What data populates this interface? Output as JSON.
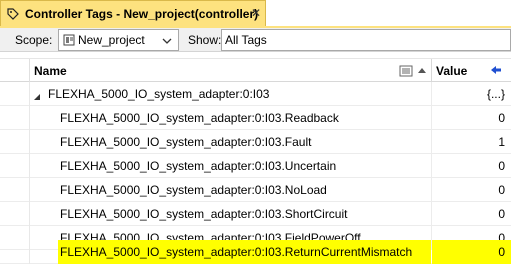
{
  "tab": {
    "title": "Controller Tags - New_project(controller)",
    "close_glyph": "✕"
  },
  "toolbar": {
    "scope_label": "Scope:",
    "scope_value": "New_project",
    "show_label": "Show:",
    "show_value": "All Tags"
  },
  "grid": {
    "columns": {
      "name": "Name",
      "value": "Value"
    },
    "parent": {
      "name": "FLEXHA_5000_IO_system_adapter:0:I03",
      "value": "{...}"
    },
    "rows": [
      {
        "name": "FLEXHA_5000_IO_system_adapter:0:I03.Readback",
        "value": "0"
      },
      {
        "name": "FLEXHA_5000_IO_system_adapter:0:I03.Fault",
        "value": "1"
      },
      {
        "name": "FLEXHA_5000_IO_system_adapter:0:I03.Uncertain",
        "value": "0"
      },
      {
        "name": "FLEXHA_5000_IO_system_adapter:0:I03.NoLoad",
        "value": "0"
      },
      {
        "name": "FLEXHA_5000_IO_system_adapter:0:I03.ShortCircuit",
        "value": "0"
      },
      {
        "name": "FLEXHA_5000_IO_system_adapter:0:I03.FieldPowerOff",
        "value": "0"
      },
      {
        "name": "FLEXHA_5000_IO_system_adapter:0:I03.ReturnCurrentMismatch",
        "value": "0",
        "highlighted": true
      }
    ]
  },
  "colors": {
    "tab_accent": "#fde27f",
    "highlight": "#ffff00",
    "arrow_blue": "#1f4fd1"
  },
  "icons": {
    "tab": "tag-icon",
    "scope": "controller-icon",
    "dropdown": "chevron-down-icon",
    "sort": "sort-filter-icon",
    "value_col": "arrow-left-icon",
    "expander": "collapse-triangle-icon"
  }
}
